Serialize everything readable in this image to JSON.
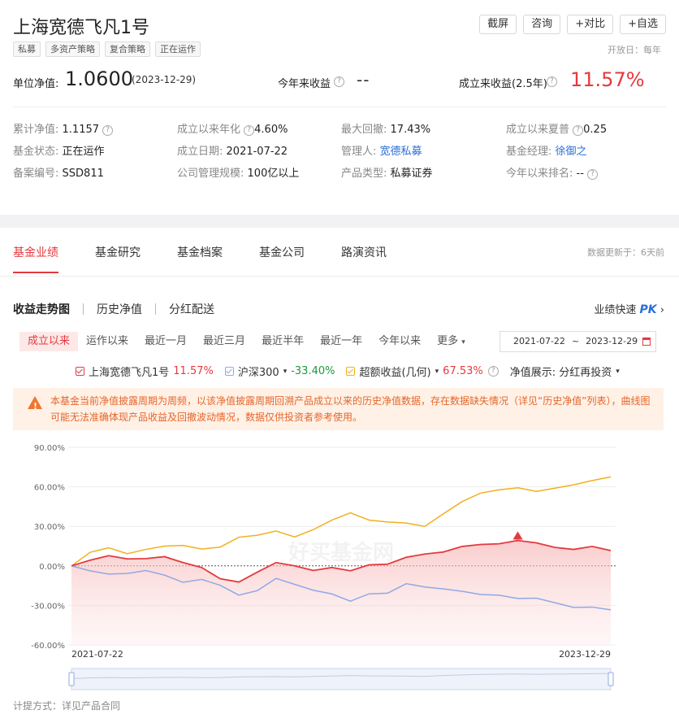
{
  "header": {
    "title": "上海宽德飞凡1号",
    "tags": [
      "私募",
      "多资产策略",
      "复合策略",
      "正在运作"
    ],
    "actions": [
      "截屏",
      "咨询",
      "+对比",
      "+自选"
    ],
    "open_day": "开放日：每年"
  },
  "summary": {
    "nav_label": "单位净值:",
    "nav_value": "1.0600",
    "nav_date": "(2023-12-29)",
    "ytd_label": "今年来收益",
    "ytd_value": "--",
    "since_label": "成立来收益(2.5年)",
    "since_value": "11.57%",
    "q": "?"
  },
  "info": {
    "cum_nav_k": "累计净值:",
    "cum_nav_v": "1.1157",
    "annual_k": "成立以来年化",
    "annual_v": "4.60%",
    "mdd_k": "最大回撤:",
    "mdd_v": "17.43%",
    "sharpe_k": "成立以来夏普",
    "sharpe_v": "0.25",
    "status_k": "基金状态:",
    "status_v": "正在运作",
    "est_k": "成立日期:",
    "est_v": "2021-07-22",
    "mgr_k": "管理人:",
    "mgr_v": "宽德私募",
    "pm_k": "基金经理:",
    "pm_v": "徐御之",
    "reg_k": "备案编号:",
    "reg_v": "SSD811",
    "scale_k": "公司管理规模:",
    "scale_v": "100亿以上",
    "type_k": "产品类型:",
    "type_v": "私募证券",
    "rank_k": "今年以来排名:",
    "rank_v": "--"
  },
  "tabs": [
    "基金业绩",
    "基金研究",
    "基金档案",
    "基金公司",
    "路演资讯"
  ],
  "update_note": "数据更新于：6天前",
  "subtabs": [
    "收益走势图",
    "历史净值",
    "分红配送"
  ],
  "pk": {
    "label": "业绩快速",
    "badge": "PK",
    "arrow": "›"
  },
  "periods": [
    "成立以来",
    "运作以来",
    "最近一月",
    "最近三月",
    "最近半年",
    "最近一年",
    "今年以来",
    "更多"
  ],
  "period_caret": "▾",
  "daterange": {
    "start": "2021-07-22",
    "tilde": "~",
    "end": "2023-12-29"
  },
  "legend": {
    "fund_name": "上海宽德飞凡1号",
    "fund_pct": "11.57%",
    "index_name": "沪深300",
    "index_pct": "-33.40%",
    "excess_name": "超额收益(几何)",
    "excess_pct": "67.53%",
    "display_label": "净值展示:",
    "display_value": "分红再投资",
    "caret": "▾"
  },
  "colors": {
    "fund": "#e5393e",
    "index": "#8fa9e6",
    "excess": "#f2b01e"
  },
  "warning": "本基金当前净值披露周期为周频，以该净值披露周期回溯产品成立以来的历史净值数据，存在数据缺失情况（详见“历史净值”列表），曲线图可能无法准确体现产品收益及回撤波动情况，数据仅供投资者参考使用。",
  "chart_data": {
    "type": "line",
    "x": [
      "2021-07",
      "2021-08",
      "2021-09",
      "2021-10",
      "2021-11",
      "2021-12",
      "2022-01",
      "2022-02",
      "2022-03",
      "2022-04",
      "2022-05",
      "2022-06",
      "2022-07",
      "2022-08",
      "2022-09",
      "2022-10",
      "2022-11",
      "2022-12",
      "2023-01",
      "2023-02",
      "2023-03",
      "2023-04",
      "2023-05",
      "2023-06",
      "2023-07",
      "2023-08",
      "2023-09",
      "2023-10",
      "2023-11",
      "2023-12"
    ],
    "series": [
      {
        "name": "上海宽德飞凡1号",
        "values": [
          0,
          4,
          8,
          6,
          5,
          7,
          3,
          -2,
          -10,
          -12,
          -4,
          2,
          0,
          -3,
          -2,
          -4,
          1,
          2,
          6,
          9,
          11,
          14,
          16,
          17,
          20,
          17,
          14,
          13,
          14,
          11.57
        ]
      },
      {
        "name": "沪深300",
        "values": [
          0,
          -4,
          -6,
          -5,
          -4,
          -7,
          -12,
          -11,
          -15,
          -22,
          -18,
          -10,
          -14,
          -18,
          -22,
          -27,
          -21,
          -20,
          -14,
          -16,
          -17,
          -20,
          -22,
          -22,
          -24,
          -25,
          -28,
          -31,
          -32,
          -33.4
        ]
      },
      {
        "name": "超额收益(几何)",
        "values": [
          0,
          10,
          14,
          10,
          12,
          15,
          16,
          12,
          14,
          22,
          24,
          26,
          22,
          28,
          34,
          40,
          35,
          34,
          32,
          30,
          40,
          48,
          55,
          58,
          60,
          56,
          59,
          62,
          64,
          67.53
        ]
      }
    ],
    "yticks": [
      "90.00%",
      "60.00%",
      "30.00%",
      "0.00%",
      "-30.00%",
      "-60.00%"
    ],
    "ylim": [
      -60,
      90
    ],
    "xlabel_start": "2021-07-22",
    "xlabel_end": "2023-12-29",
    "watermark": "好买基金网"
  },
  "footer_note": "计提方式：详见产品合同"
}
